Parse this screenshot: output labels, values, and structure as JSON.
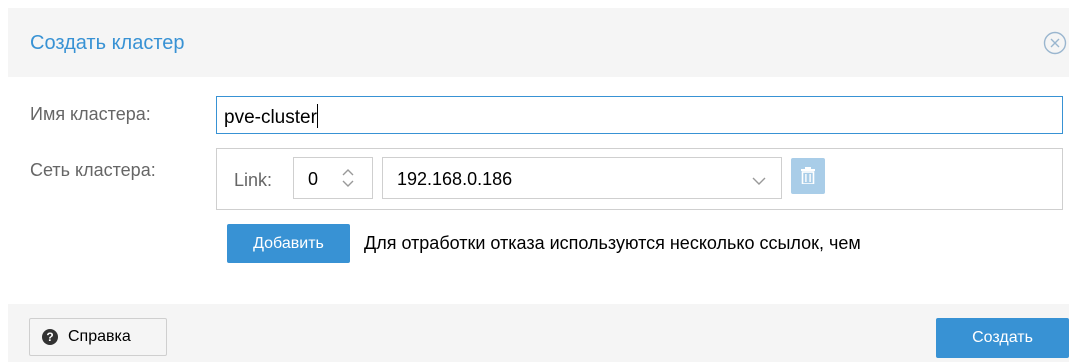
{
  "dialog": {
    "title": "Создать кластер",
    "close_icon": "close-circle-icon"
  },
  "form": {
    "cluster_name_label": "Имя кластера:",
    "cluster_name_value": "pve-cluster",
    "cluster_network_label": "Сеть кластера:",
    "link_label": "Link:",
    "link_number": "0",
    "link_address": "192.168.0.186",
    "add_button_label": "Добавить",
    "failover_note": "Для отработки отказа используются несколько ссылок, чем"
  },
  "footer": {
    "help_button_label": "Справка",
    "help_icon": "question-circle-icon",
    "create_button_label": "Создать"
  },
  "colors": {
    "accent": "#3892d4",
    "disabled_accent": "#a9cde8",
    "panel_bg": "#f5f5f5"
  }
}
